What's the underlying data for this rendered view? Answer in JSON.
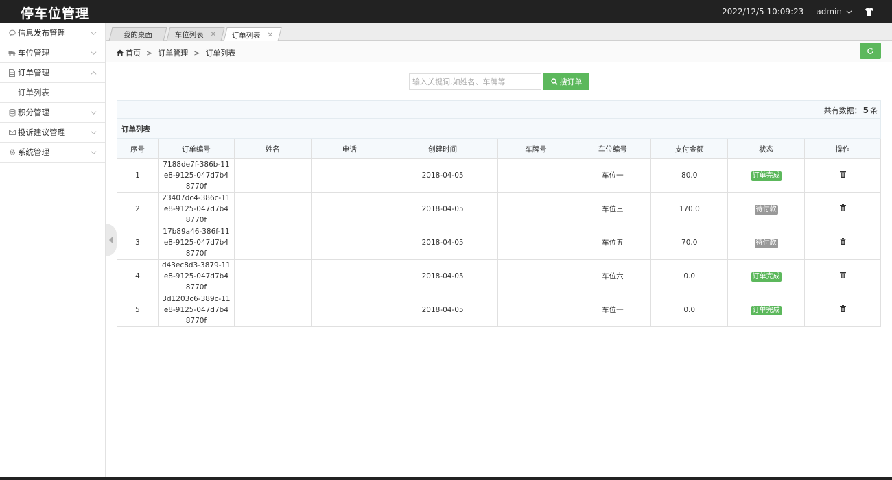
{
  "header": {
    "title": "停车位管理",
    "datetime": "2022/12/5 10:09:23",
    "user": "admin"
  },
  "sidebar": {
    "items": [
      {
        "label": "信息发布管理",
        "icon": "comment-icon"
      },
      {
        "label": "车位管理",
        "icon": "truck-icon"
      },
      {
        "label": "订单管理",
        "icon": "file-icon",
        "expanded": true,
        "children": [
          "订单列表"
        ]
      },
      {
        "label": "积分管理",
        "icon": "database-icon"
      },
      {
        "label": "投诉建议管理",
        "icon": "envelope-icon"
      },
      {
        "label": "系统管理",
        "icon": "gear-icon"
      }
    ]
  },
  "tabs": [
    {
      "label": "我的桌面",
      "closable": false,
      "active": false
    },
    {
      "label": "车位列表",
      "closable": true,
      "active": false
    },
    {
      "label": "订单列表",
      "closable": true,
      "active": true
    }
  ],
  "breadcrumb": {
    "home": "首页",
    "level1": "订单管理",
    "level2": "订单列表",
    "separator": ">"
  },
  "search": {
    "placeholder": "输入关键词,如姓名、车牌等",
    "button": "搜订单"
  },
  "summary": {
    "prefix": "共有数据：",
    "count": "5",
    "suffix": "条"
  },
  "panel_title": "订单列表",
  "table": {
    "columns": [
      "序号",
      "订单编号",
      "姓名",
      "电话",
      "创建时间",
      "车牌号",
      "车位编号",
      "支付金额",
      "状态",
      "操作"
    ],
    "rows": [
      {
        "index": "1",
        "order_no": "7188de7f-386b-11e8-9125-047d7b48770f",
        "name": "",
        "phone": "",
        "created": "2018-04-05",
        "plate": "",
        "space": "车位一",
        "amount": "80.0",
        "status": "订单完成",
        "status_type": "done"
      },
      {
        "index": "2",
        "order_no": "23407dc4-386c-11e8-9125-047d7b48770f",
        "name": "",
        "phone": "",
        "created": "2018-04-05",
        "plate": "",
        "space": "车位三",
        "amount": "170.0",
        "status": "待付款",
        "status_type": "pending"
      },
      {
        "index": "3",
        "order_no": "17b89a46-386f-11e8-9125-047d7b48770f",
        "name": "",
        "phone": "",
        "created": "2018-04-05",
        "plate": "",
        "space": "车位五",
        "amount": "70.0",
        "status": "待付款",
        "status_type": "pending"
      },
      {
        "index": "4",
        "order_no": "d43ec8d3-3879-11e8-9125-047d7b48770f",
        "name": "",
        "phone": "",
        "created": "2018-04-05",
        "plate": "",
        "space": "车位六",
        "amount": "0.0",
        "status": "订单完成",
        "status_type": "done"
      },
      {
        "index": "5",
        "order_no": "3d1203c6-389c-11e8-9125-047d7b48770f",
        "name": "",
        "phone": "",
        "created": "2018-04-05",
        "plate": "",
        "space": "车位一",
        "amount": "0.0",
        "status": "订单完成",
        "status_type": "done"
      }
    ]
  },
  "colors": {
    "header_bg": "#222222",
    "accent_green": "#5cb85c",
    "badge_gray": "#999999"
  }
}
